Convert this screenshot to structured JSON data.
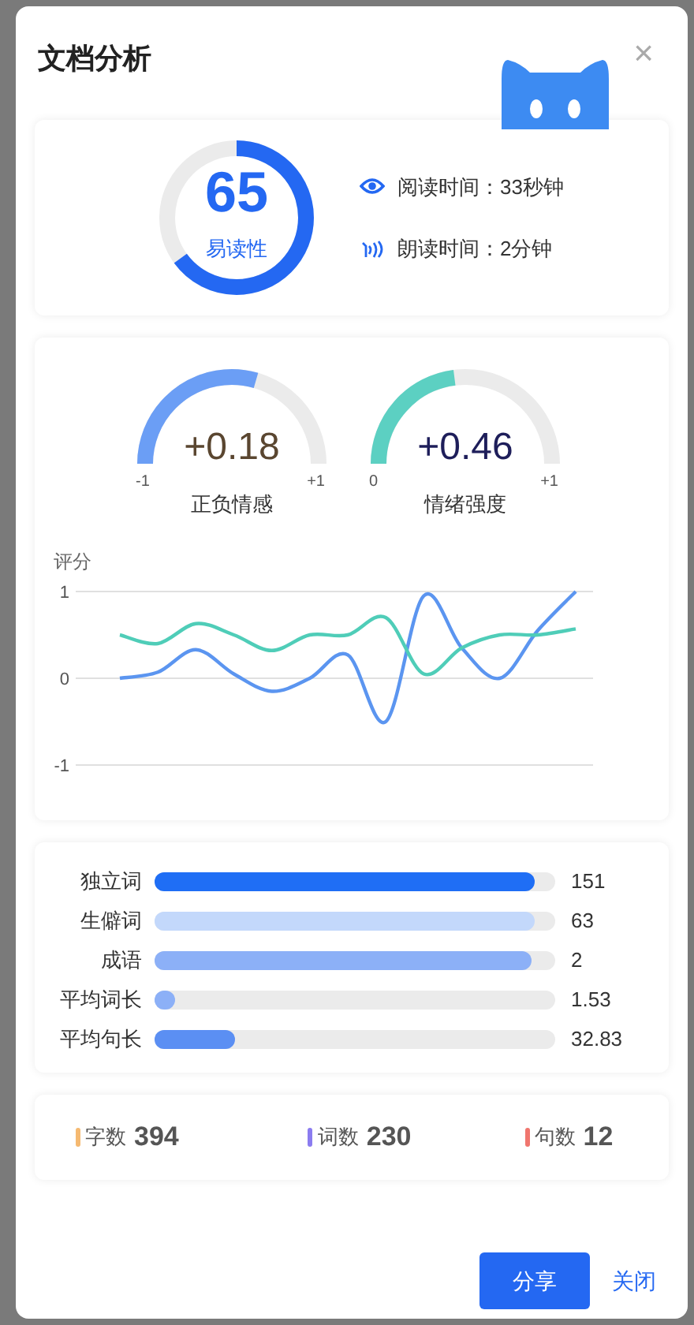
{
  "dialog": {
    "title": "文档分析",
    "close_glyph": "×"
  },
  "readability": {
    "score": "65",
    "label": "易读性",
    "level": 0.65,
    "items": [
      {
        "kind": "eye",
        "text": "阅读时间：33秒钟"
      },
      {
        "kind": "voice",
        "text": "朗读时间：2分钟"
      }
    ]
  },
  "gauges": [
    {
      "value": "+0.18",
      "label": "正负情感",
      "min_label": "-1",
      "max_label": "+1",
      "color": "#6b9ef5"
    },
    {
      "value": "+0.46",
      "label": "情绪强度",
      "min_label": "0",
      "max_label": "+1",
      "color": "#5cd0c2"
    }
  ],
  "chart_data": {
    "type": "line",
    "ylabel": "评分",
    "ylim": [
      -1,
      1
    ],
    "yticks": [
      1,
      0,
      -1
    ],
    "series": [
      {
        "color": "#5b95f0",
        "values": [
          0,
          0.07,
          0.33,
          0.05,
          -0.15,
          0,
          0.27,
          -0.5,
          0.95,
          0.35,
          0,
          0.55,
          1
        ]
      },
      {
        "color": "#4fcdb8",
        "values": [
          0.5,
          0.4,
          0.63,
          0.5,
          0.32,
          0.5,
          0.5,
          0.7,
          0.05,
          0.35,
          0.5,
          0.5,
          0.57
        ]
      }
    ]
  },
  "metrics": [
    {
      "label": "独立词",
      "value": "151",
      "level": 0.95,
      "color": "#1f6ef5"
    },
    {
      "label": "生僻词",
      "value": "63",
      "level": 0.95,
      "color": "#c3d8fb"
    },
    {
      "label": "成语",
      "value": "2",
      "level": 0.94,
      "color": "#8cb0f7"
    },
    {
      "label": "平均词长",
      "value": "1.53",
      "level": 0.05,
      "color": "#8cb0f7"
    },
    {
      "label": "平均句长",
      "value": "32.83",
      "level": 0.2,
      "color": "#5b8ff3"
    }
  ],
  "counts": [
    {
      "label": "字数",
      "value": "394",
      "color": "#f5b971"
    },
    {
      "label": "词数",
      "value": "230",
      "color": "#8b7cf0"
    },
    {
      "label": "句数",
      "value": "12",
      "color": "#f0766e"
    }
  ],
  "buttons": {
    "primary": "分享",
    "link": "关闭"
  }
}
